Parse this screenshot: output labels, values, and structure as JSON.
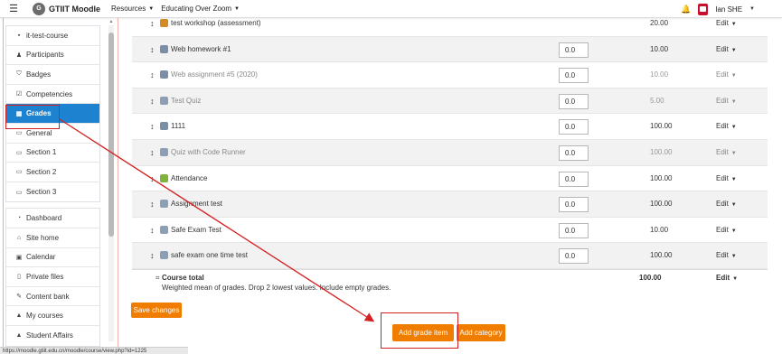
{
  "navbar": {
    "site_name": "GTIIT Moodle",
    "logo_text": "G",
    "menu_resources": "Resources",
    "menu_educating": "Educating Over Zoom",
    "user_name": "Ian SHE"
  },
  "sidebar": {
    "course_items": [
      {
        "label": "it-test-course",
        "icon": "cap-icon"
      },
      {
        "label": "Participants",
        "icon": "users-icon"
      },
      {
        "label": "Badges",
        "icon": "shield-icon"
      },
      {
        "label": "Competencies",
        "icon": "check-square-icon"
      },
      {
        "label": "Grades",
        "icon": "table-icon",
        "active": true
      },
      {
        "label": "General",
        "icon": "folder-icon"
      },
      {
        "label": "Section 1",
        "icon": "folder-icon"
      },
      {
        "label": "Section 2",
        "icon": "folder-icon"
      },
      {
        "label": "Section 3",
        "icon": "folder-icon"
      }
    ],
    "site_items": [
      {
        "label": "Dashboard",
        "icon": "dashboard-icon"
      },
      {
        "label": "Site home",
        "icon": "home-icon"
      },
      {
        "label": "Calendar",
        "icon": "calendar-icon"
      },
      {
        "label": "Private files",
        "icon": "file-icon"
      },
      {
        "label": "Content bank",
        "icon": "paint-brush-icon"
      },
      {
        "label": "My courses",
        "icon": "cap-icon"
      },
      {
        "label": "Student Affairs",
        "icon": "cap-icon"
      }
    ]
  },
  "grades": {
    "rows": [
      {
        "name": "test workshop (assessment)",
        "weight": "",
        "max": "20.00",
        "edit": "Edit",
        "dimmed": false,
        "type": "workshop"
      },
      {
        "name": "Web homework #1",
        "weight": "0.0",
        "max": "10.00",
        "edit": "Edit",
        "dimmed": false,
        "type": "assign"
      },
      {
        "name": "Web assignment #5 (2020)",
        "weight": "0.0",
        "max": "10.00",
        "edit": "Edit",
        "dimmed": true,
        "type": "assign"
      },
      {
        "name": "Test Quiz",
        "weight": "0.0",
        "max": "5.00",
        "edit": "Edit",
        "dimmed": true,
        "type": "quiz"
      },
      {
        "name": "1111",
        "weight": "0.0",
        "max": "100.00",
        "edit": "Edit",
        "dimmed": false,
        "type": "assign"
      },
      {
        "name": "Quiz with Code Runner",
        "weight": "0.0",
        "max": "100.00",
        "edit": "Edit",
        "dimmed": true,
        "type": "quiz"
      },
      {
        "name": "Attendance",
        "weight": "0.0",
        "max": "100.00",
        "edit": "Edit",
        "dimmed": false,
        "type": "attendance"
      },
      {
        "name": "Assignment test",
        "weight": "0.0",
        "max": "100.00",
        "edit": "Edit",
        "dimmed": false,
        "type": "quiz"
      },
      {
        "name": "Safe Exam Test",
        "weight": "0.0",
        "max": "10.00",
        "edit": "Edit",
        "dimmed": false,
        "type": "quiz"
      },
      {
        "name": "safe exam one time test",
        "weight": "0.0",
        "max": "100.00",
        "edit": "Edit",
        "dimmed": false,
        "type": "quiz"
      }
    ],
    "course_total": {
      "label": "Course total",
      "description": "Weighted mean of grades. Drop 2 lowest values. Include empty grades.",
      "max": "100.00",
      "edit": "Edit"
    }
  },
  "buttons": {
    "save": "Save changes",
    "add_grade_item": "Add grade item",
    "add_category": "Add category"
  },
  "status_bar": "https://moodle.gtiit.edu.cn/moodle/course/view.php?id=1225",
  "colors": {
    "accent_orange": "#f07c00",
    "active_blue": "#1d82d0",
    "annotation_red": "#d42020"
  }
}
